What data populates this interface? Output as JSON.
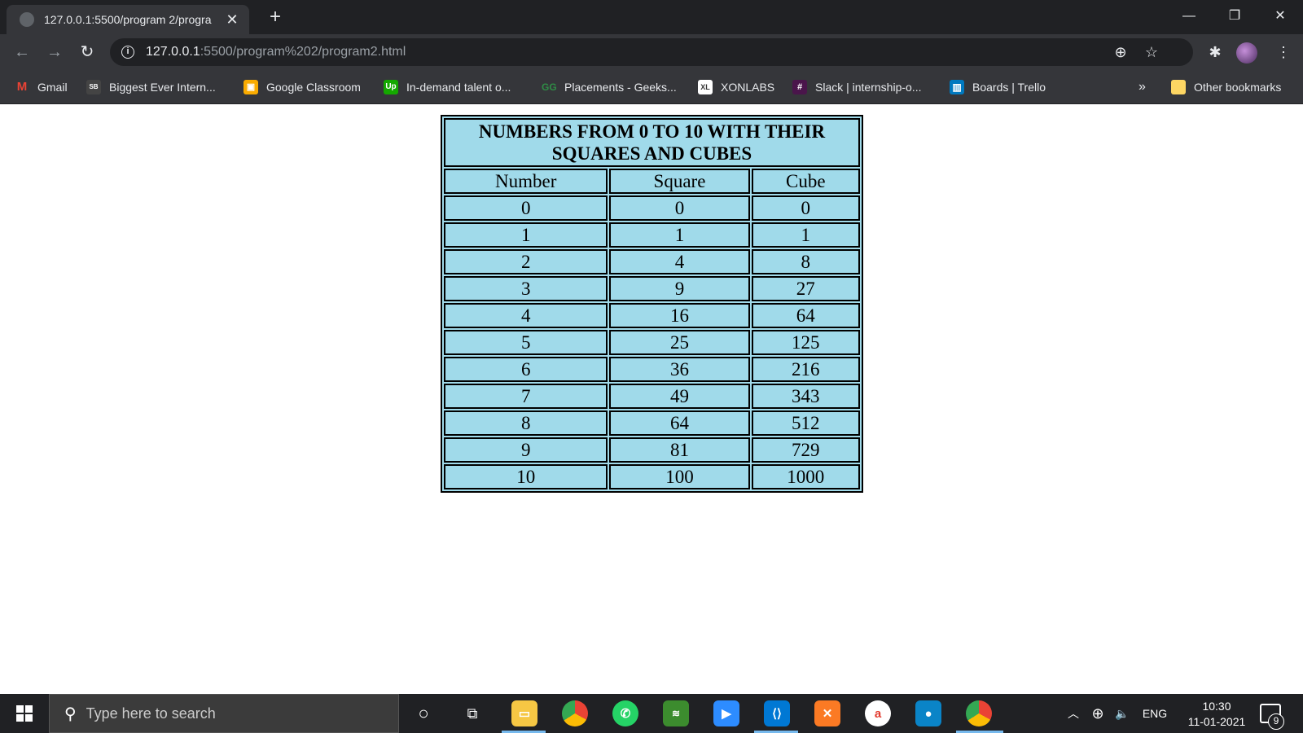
{
  "browser": {
    "tab": {
      "title": "127.0.0.1:5500/program 2/progra"
    },
    "url": {
      "host": "127.0.0.1",
      "rest": ":5500/program%202/program2.html"
    },
    "bookmarks": [
      {
        "label": "Gmail",
        "icon": "gmail-icon",
        "color": "#ea4335"
      },
      {
        "label": "Biggest Ever Intern...",
        "icon": "sb-icon",
        "color": "#444444"
      },
      {
        "label": "Google Classroom",
        "icon": "classroom-icon",
        "color": "#f9ab00"
      },
      {
        "label": "In-demand talent o...",
        "icon": "upwork-icon",
        "color": "#14a800"
      },
      {
        "label": "Placements - Geeks...",
        "icon": "geeksforgeeks-icon",
        "color": "#2f8d46"
      },
      {
        "label": "XONLABS",
        "icon": "xonlabs-icon",
        "color": "#ffffff"
      },
      {
        "label": "Slack | internship-o...",
        "icon": "slack-icon",
        "color": "#4a154b"
      },
      {
        "label": "Boards | Trello",
        "icon": "trello-icon",
        "color": "#0079bf"
      }
    ],
    "overflow_label": "»",
    "other_bookmarks": "Other bookmarks"
  },
  "table": {
    "caption_line1": "NUMBERS FROM 0 TO 10 WITH THEIR",
    "caption_line2": "SQUARES AND CUBES",
    "headers": [
      "Number",
      "Square",
      "Cube"
    ],
    "rows": [
      [
        "0",
        "0",
        "0"
      ],
      [
        "1",
        "1",
        "1"
      ],
      [
        "2",
        "4",
        "8"
      ],
      [
        "3",
        "9",
        "27"
      ],
      [
        "4",
        "16",
        "64"
      ],
      [
        "5",
        "25",
        "125"
      ],
      [
        "6",
        "36",
        "216"
      ],
      [
        "7",
        "49",
        "343"
      ],
      [
        "8",
        "64",
        "512"
      ],
      [
        "9",
        "81",
        "729"
      ],
      [
        "10",
        "100",
        "1000"
      ]
    ],
    "background": "#a0daea"
  },
  "taskbar": {
    "search_placeholder": "Type here to search",
    "language": "ENG",
    "time": "10:30",
    "date": "11-01-2021",
    "notification_count": "9",
    "apps": [
      "cortana-icon",
      "task-view-icon",
      "file-explorer-icon",
      "chrome-icon",
      "whatsapp-icon",
      "app-icon",
      "zoom-icon",
      "vscode-icon",
      "xampp-icon",
      "app-icon",
      "screen-recorder-icon",
      "chrome-profile-icon"
    ]
  }
}
